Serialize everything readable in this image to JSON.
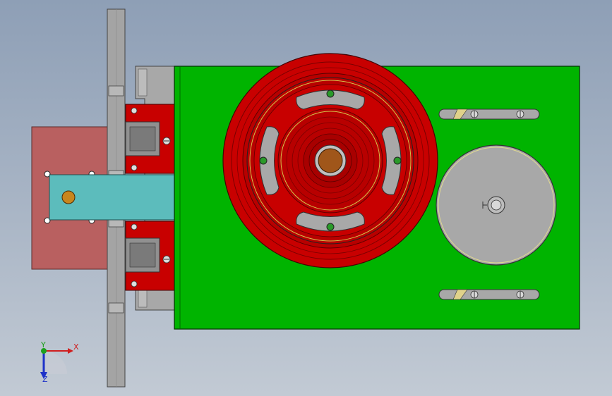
{
  "viewport": {
    "background_top": "#8e9fb6",
    "background_bottom": "#c2cad4"
  },
  "model": {
    "plate_color": "#00b400",
    "pulley_color": "#c80000",
    "pulley_dark": "#8e0000",
    "block_color": "#b96060",
    "arm_color": "#5cbcbc",
    "rail_color": "#a4a4a4",
    "disc_color": "#a8a8a8",
    "hub_color": "#a0561a",
    "screw_color": "#2a9a2a",
    "pin_color": "#c8861e"
  },
  "triad": {
    "x_label": "X",
    "y_label": "Y",
    "z_label": "Z",
    "x_color": "#d01e1e",
    "y_color": "#1ea01e",
    "z_color": "#1e32c8"
  }
}
